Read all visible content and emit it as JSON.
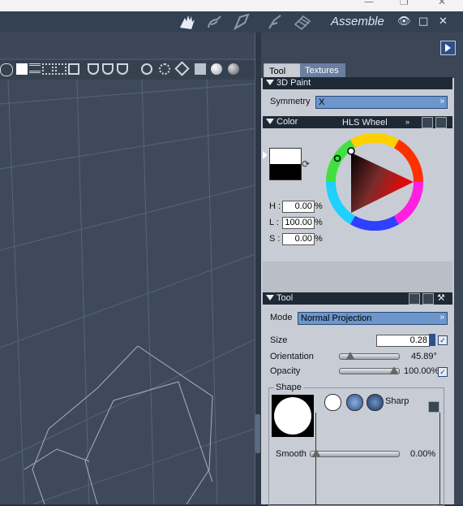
{
  "os_bar": {
    "minimize": "—",
    "restore": "❐",
    "close": "✕"
  },
  "title_bar": {
    "rooms": [
      "pose-room-icon",
      "face-room-icon",
      "hair-room-icon",
      "cloth-room-icon",
      "material-room-icon"
    ],
    "active_room": "Assemble",
    "window_controls": {
      "visibility": "👁",
      "maximize": "□",
      "close": "✕"
    }
  },
  "panel": {
    "tabs": [
      {
        "label": "Tool",
        "active": true
      },
      {
        "label": "Textures",
        "active": false
      }
    ],
    "paint_section": {
      "title": "3D Paint",
      "symmetry_label": "Symmetry",
      "symmetry_value": "X"
    },
    "color_section": {
      "title": "Color",
      "mode": "HLS Wheel",
      "h_label": "H :",
      "h_value": "0.00",
      "h_unit": "%",
      "l_label": "L :",
      "l_value": "100.00",
      "l_unit": "%",
      "s_label": "S :",
      "s_value": "0.00",
      "s_unit": "%",
      "swatch_front": "#ffffff",
      "swatch_back": "#000000"
    },
    "tool_section": {
      "title": "Tool",
      "mode_label": "Mode",
      "mode_value": "Normal Projection",
      "size_label": "Size",
      "size_value": "0.28",
      "orientation_label": "Orientation",
      "orientation_value": "45.89°",
      "opacity_label": "Opacity",
      "opacity_value": "100.00%",
      "shape_label": "Shape",
      "sharp_label": "Sharp",
      "smooth_label": "Smooth",
      "smooth_value": "0.00%"
    }
  },
  "colors": {
    "accent": "#6c96cc",
    "panel_bg": "#c8cdd5",
    "header_bg": "#1f2936",
    "viewport_bg": "#3e4a5c"
  }
}
